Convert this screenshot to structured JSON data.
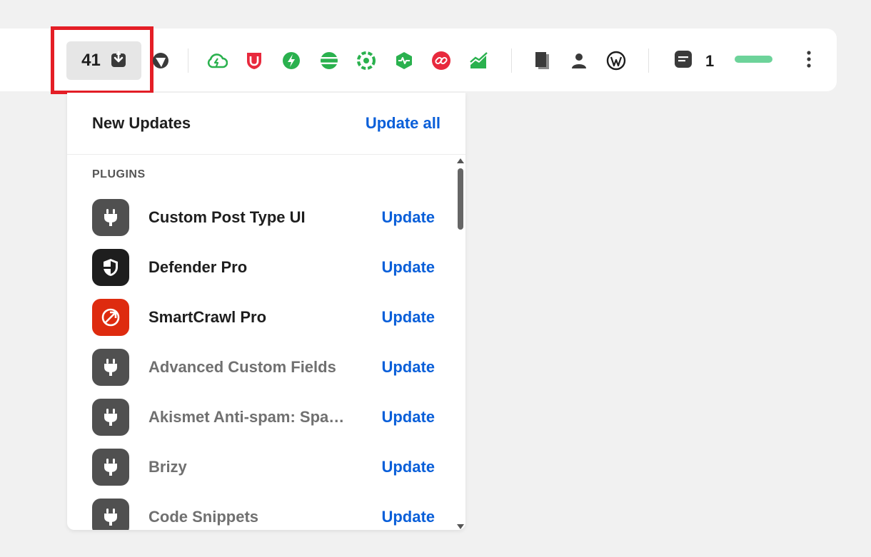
{
  "toolbar": {
    "updates_count": "41",
    "comments_count": "1",
    "icons": [
      "theme-icon",
      "cloud-icon",
      "shield-icon",
      "bolt-icon",
      "stripes-icon",
      "camera-aperture-icon",
      "heartbeat-icon",
      "link-icon",
      "chart-icon",
      "pages-icon",
      "user-icon",
      "wordpress-icon",
      "comment-icon",
      "kebab-menu-icon"
    ],
    "accent_green": "#2ab14e",
    "accent_red": "#e8293d"
  },
  "dropdown": {
    "title": "New Updates",
    "update_all_label": "Update all",
    "section_label": "PLUGINS",
    "items": [
      {
        "name": "Custom Post Type UI",
        "action": "Update",
        "icon": "plug-icon"
      },
      {
        "name": "Defender Pro",
        "action": "Update",
        "icon": "defender-shield-icon"
      },
      {
        "name": "SmartCrawl Pro",
        "action": "Update",
        "icon": "smartcrawl-icon"
      },
      {
        "name": "Advanced Custom Fields",
        "action": "Update",
        "icon": "plug-icon"
      },
      {
        "name": "Akismet Anti-spam: Spam Protection",
        "action": "Update",
        "icon": "plug-icon"
      },
      {
        "name": "Brizy",
        "action": "Update",
        "icon": "plug-icon"
      },
      {
        "name": "Code Snippets",
        "action": "Update",
        "icon": "plug-icon"
      }
    ]
  }
}
